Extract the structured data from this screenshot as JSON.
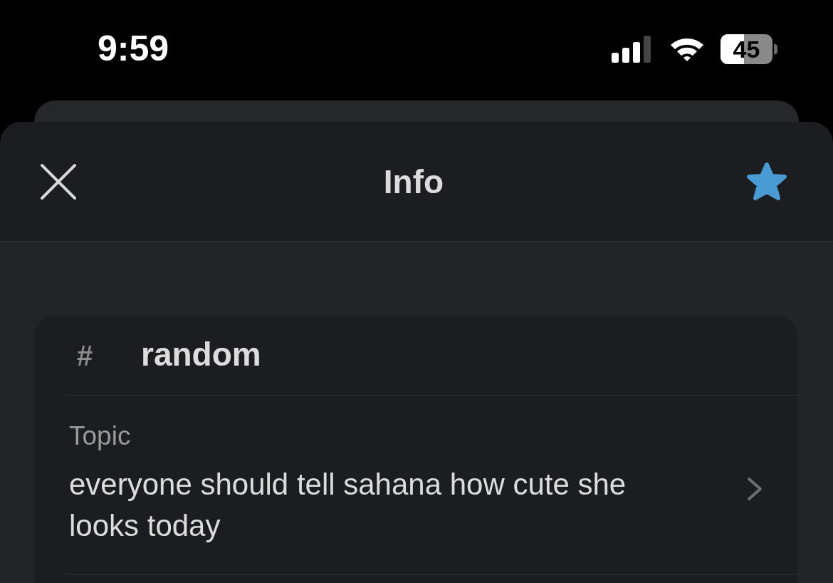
{
  "status_bar": {
    "time": "9:59",
    "battery": {
      "text": "45",
      "level": 0.45
    }
  },
  "header": {
    "title": "Info",
    "starred": true
  },
  "channel": {
    "prefix": "#",
    "name": "random"
  },
  "details": [
    {
      "label": "Topic",
      "value": "everyone should tell sahana how cute she looks today"
    }
  ]
}
